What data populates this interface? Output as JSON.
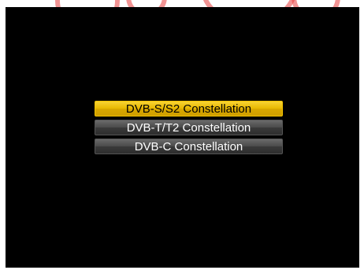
{
  "menu": {
    "items": [
      {
        "label": "DVB-S/S2 Constellation",
        "selected": true
      },
      {
        "label": "DVB-T/T2 Constellation",
        "selected": false
      },
      {
        "label": "DVB-C Constellation",
        "selected": false
      }
    ]
  },
  "colors": {
    "screen_background": "#000000",
    "selected_item": "#e8b800",
    "unselected_item": "#4a4a4a",
    "decor_accent": "#e83c3c"
  }
}
